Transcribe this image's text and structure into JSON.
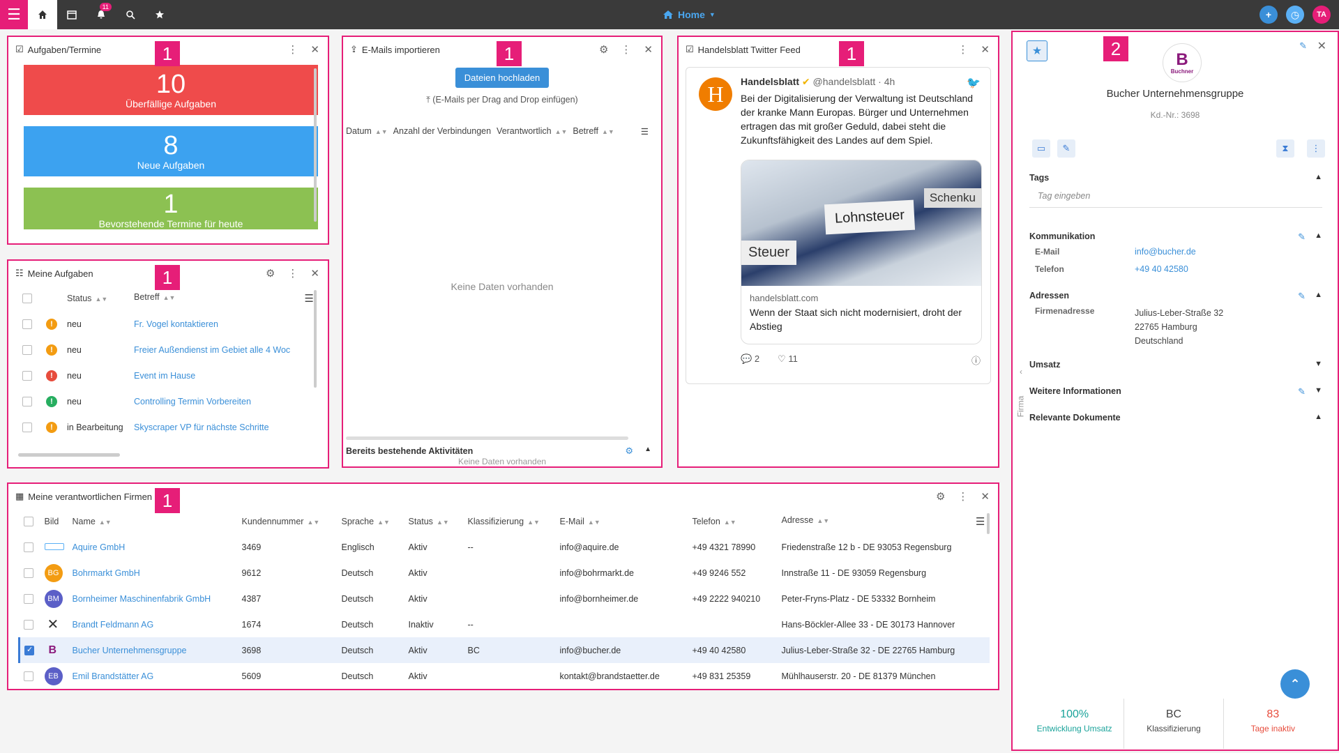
{
  "topbar": {
    "notif_count": "11",
    "home_label": "Home",
    "user_initials": "TA",
    "colors": {
      "pink": "#e61e78",
      "blue": "#3a8fd8",
      "bar": "#3a3a3a"
    }
  },
  "badges": {
    "one": "1",
    "two": "2"
  },
  "tasks_widget": {
    "title": "Aufgaben/Termine",
    "tiles": [
      {
        "num": "10",
        "label": "Überfällige Aufgaben",
        "color": "#ef4b4b"
      },
      {
        "num": "8",
        "label": "Neue Aufgaben",
        "color": "#3ca2f0"
      },
      {
        "num": "1",
        "label": "Bevorstehende Termine für heute",
        "color": "#8cc152"
      }
    ]
  },
  "email_widget": {
    "title": "E-Mails importieren",
    "upload_button": "Dateien hochladen",
    "drag_hint": "(E-Mails per Drag and Drop einfügen)",
    "columns": [
      "Datum",
      "Anzahl der Verbindungen",
      "Verantwortlich",
      "Betreff"
    ],
    "empty": "Keine Daten vorhanden",
    "footer_title": "Bereits bestehende Aktivitäten",
    "footer_empty": "Keine Daten vorhanden"
  },
  "twitter_widget": {
    "title": "Handelsblatt Twitter Feed",
    "author": "Handelsblatt",
    "handle": "@handelsblatt · 4h",
    "text": "Bei der Digitalisierung der Verwaltung ist Deutschland der kranke Mann Europas. Bürger und Unternehmen ertragen das mit großer Geduld, dabei steht die Zukunftsfähigkeit des Landes auf dem Spiel.",
    "image_words": {
      "lohn": "Lohnsteuer",
      "steuer": "Steuer",
      "schenk": "Schenku"
    },
    "link_domain": "handelsblatt.com",
    "link_title": "Wenn der Staat sich nicht modernisiert, droht der Abstieg",
    "replies": "2",
    "likes": "11"
  },
  "my_tasks": {
    "title": "Meine Aufgaben",
    "columns": [
      "Status",
      "Betreff"
    ],
    "rows": [
      {
        "status": "neu",
        "subject": "Fr. Vogel kontaktieren",
        "color": "#f39c12"
      },
      {
        "status": "neu",
        "subject": "Freier Außendienst im Gebiet alle 4 Woc",
        "color": "#f39c12"
      },
      {
        "status": "neu",
        "subject": "Event im Hause",
        "color": "#e74c3c"
      },
      {
        "status": "neu",
        "subject": "Controlling Termin Vorbereiten",
        "color": "#27ae60"
      },
      {
        "status": "in Bearbeitung",
        "subject": "Skyscraper VP für nächste Schritte",
        "color": "#f39c12"
      }
    ]
  },
  "companies": {
    "title": "Meine verantwortlichen Firmen",
    "columns": [
      "Bild",
      "Name",
      "Kundennummer",
      "Sprache",
      "Status",
      "Klassifizierung",
      "E-Mail",
      "Telefon",
      "Adresse"
    ],
    "rows": [
      {
        "avatar": "",
        "avatar_color": "#ffffff",
        "name": "Aquire GmbH",
        "nr": "3469",
        "lang": "Englisch",
        "status": "Aktiv",
        "klass": "--",
        "email": "info@aquire.de",
        "tel": "+49 4321 78990",
        "addr": "Friedenstraße 12 b - DE 93053 Regensburg"
      },
      {
        "avatar": "BG",
        "avatar_color": "#f39c12",
        "name": "Bohrmarkt GmbH",
        "nr": "9612",
        "lang": "Deutsch",
        "status": "Aktiv",
        "klass": "",
        "email": "info@bohrmarkt.de",
        "tel": "+49 9246 552",
        "addr": "Innstraße 11 - DE 93059 Regensburg"
      },
      {
        "avatar": "BM",
        "avatar_color": "#5b5fc7",
        "name": "Bornheimer Maschinenfabrik GmbH",
        "nr": "4387",
        "lang": "Deutsch",
        "status": "Aktiv",
        "klass": "",
        "email": "info@bornheimer.de",
        "tel": "+49 2222 940210",
        "addr": "Peter-Fryns-Platz - DE 53332 Bornheim"
      },
      {
        "avatar": "✕",
        "avatar_color": "#ffffff",
        "name": "Brandt Feldmann AG",
        "nr": "1674",
        "lang": "Deutsch",
        "status": "Inaktiv",
        "klass": "--",
        "email": "",
        "tel": "",
        "addr": "Hans-Böckler-Allee 33 - DE 30173 Hannover"
      },
      {
        "avatar": "B",
        "avatar_color": "#ffffff",
        "name": "Bucher Unternehmensgruppe",
        "nr": "3698",
        "lang": "Deutsch",
        "status": "Aktiv",
        "klass": "BC",
        "email": "info@bucher.de",
        "tel": "+49 40 42580",
        "addr": "Julius-Leber-Straße 32 - DE 22765 Hamburg",
        "selected": true
      },
      {
        "avatar": "EB",
        "avatar_color": "#5b5fc7",
        "name": "Emil Brandstätter AG",
        "nr": "5609",
        "lang": "Deutsch",
        "status": "Aktiv",
        "klass": "",
        "email": "kontakt@brandstaetter.de",
        "tel": "+49 831 25359",
        "addr": "Mühlhauserstr. 20 - DE 81379 München"
      }
    ]
  },
  "detail": {
    "logo_letter": "B",
    "logo_text": "Buchner",
    "company": "Bucher Unternehmensgruppe",
    "kdnr": "Kd.-Nr.: 3698",
    "side_tab": "Firma",
    "tags_h": "Tags",
    "tags_placeholder": "Tag eingeben",
    "komm_h": "Kommunikation",
    "email_k": "E-Mail",
    "email_v": "info@bucher.de",
    "tel_k": "Telefon",
    "tel_v": "+49 40 42580",
    "addr_h": "Adressen",
    "addr_k": "Firmenadresse",
    "addr_l1": "Julius-Leber-Straße 32",
    "addr_l2": "22765 Hamburg",
    "addr_l3": "Deutschland",
    "umsatz_h": "Umsatz",
    "weitere_h": "Weitere Informationen",
    "docs_h": "Relevante Dokumente",
    "stats": [
      {
        "value": "100%",
        "label": "Entwicklung Umsatz",
        "color": "#1aa39a"
      },
      {
        "value": "BC",
        "label": "Klassifizierung",
        "color": "#444444"
      },
      {
        "value": "83",
        "label": "Tage inaktiv",
        "color": "#e74c3c"
      }
    ]
  }
}
